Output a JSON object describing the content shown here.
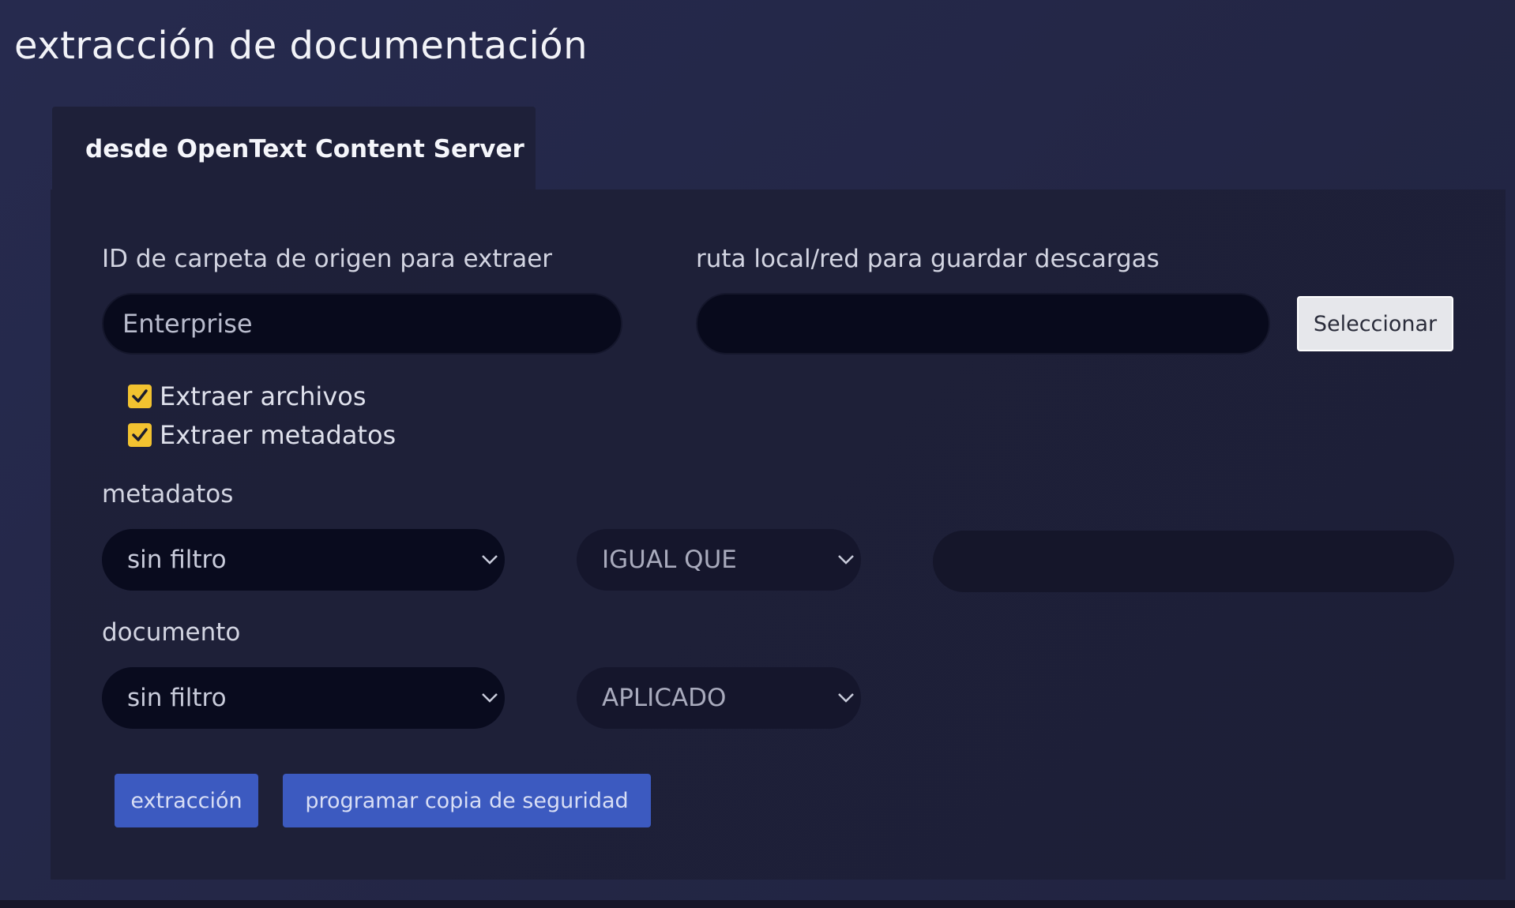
{
  "page": {
    "title": "extracción de documentación"
  },
  "tab": {
    "label": "desde OpenText Content Server"
  },
  "form": {
    "folder_id_label": "ID de carpeta de origen para extraer",
    "folder_id_placeholder": "Enterprise",
    "path_label": "ruta local/red para guardar descargas",
    "path_value": "",
    "select_button": "Seleccionar",
    "extract_files_label": "Extraer archivos",
    "extract_files_checked": true,
    "extract_metadata_label": "Extraer metadatos",
    "extract_metadata_checked": true,
    "metadata_label": "metadatos",
    "metadata_filter_value": "sin filtro",
    "metadata_operator_value": "IGUAL QUE",
    "metadata_text_value": "",
    "document_label": "documento",
    "document_filter_value": "sin filtro",
    "document_state_value": "APLICADO"
  },
  "actions": {
    "extract_label": "extracción",
    "schedule_backup_label": "programar copia de seguridad"
  },
  "colors": {
    "background": "#252848",
    "panel": "#1e2039",
    "checkbox": "#f2c230",
    "primary_button": "#3c5ac0"
  }
}
